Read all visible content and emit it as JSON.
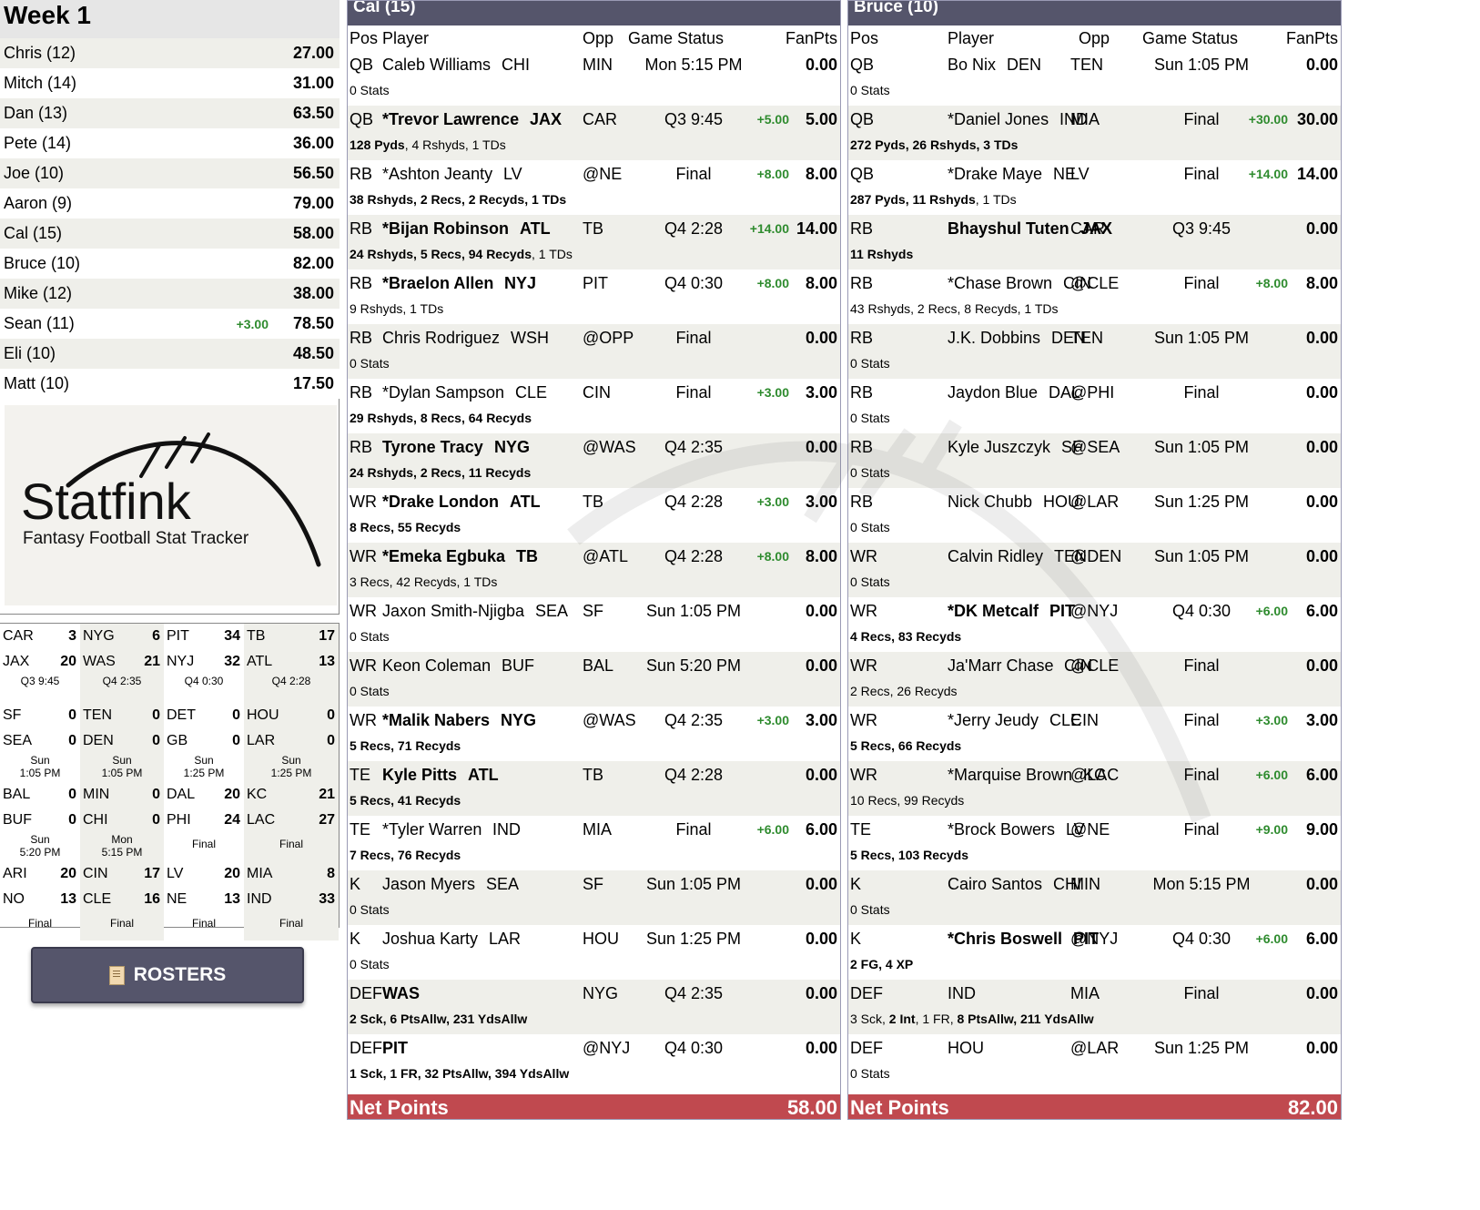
{
  "week_title": "Week 1",
  "standings": [
    {
      "name": "Chris (12)",
      "delta": "",
      "score": "27.00"
    },
    {
      "name": "Mitch (14)",
      "delta": "",
      "score": "31.00"
    },
    {
      "name": "Dan (13)",
      "delta": "",
      "score": "63.50"
    },
    {
      "name": "Pete (14)",
      "delta": "",
      "score": "36.00"
    },
    {
      "name": "Joe (10)",
      "delta": "",
      "score": "56.50"
    },
    {
      "name": "Aaron (9)",
      "delta": "",
      "score": "79.00"
    },
    {
      "name": "Cal (15)",
      "delta": "",
      "score": "58.00"
    },
    {
      "name": "Bruce (10)",
      "delta": "",
      "score": "82.00"
    },
    {
      "name": "Mike (12)",
      "delta": "",
      "score": "38.00"
    },
    {
      "name": "Sean (11)",
      "delta": "+3.00",
      "score": "78.50"
    },
    {
      "name": "Eli (10)",
      "delta": "",
      "score": "48.50"
    },
    {
      "name": "Matt (10)",
      "delta": "",
      "score": "17.50"
    }
  ],
  "logo": {
    "name": "Statfink",
    "tagline": "Fantasy Football Stat Tracker"
  },
  "games": [
    {
      "t1": "CAR",
      "s1": "3",
      "t2": "JAX",
      "s2": "20",
      "status": [
        "Q3 9:45"
      ]
    },
    {
      "t1": "NYG",
      "s1": "6",
      "t2": "WAS",
      "s2": "21",
      "status": [
        "Q4 2:35"
      ]
    },
    {
      "t1": "PIT",
      "s1": "34",
      "t2": "NYJ",
      "s2": "32",
      "status": [
        "Q4 0:30"
      ]
    },
    {
      "t1": "TB",
      "s1": "17",
      "t2": "ATL",
      "s2": "13",
      "status": [
        "Q4 2:28"
      ]
    },
    {
      "t1": "SF",
      "s1": "0",
      "t2": "SEA",
      "s2": "0",
      "status": [
        "Sun",
        "1:05 PM"
      ]
    },
    {
      "t1": "TEN",
      "s1": "0",
      "t2": "DEN",
      "s2": "0",
      "status": [
        "Sun",
        "1:05 PM"
      ]
    },
    {
      "t1": "DET",
      "s1": "0",
      "t2": "GB",
      "s2": "0",
      "status": [
        "Sun",
        "1:25 PM"
      ]
    },
    {
      "t1": "HOU",
      "s1": "0",
      "t2": "LAR",
      "s2": "0",
      "status": [
        "Sun",
        "1:25 PM"
      ]
    },
    {
      "t1": "BAL",
      "s1": "0",
      "t2": "BUF",
      "s2": "0",
      "status": [
        "Sun",
        "5:20 PM"
      ]
    },
    {
      "t1": "MIN",
      "s1": "0",
      "t2": "CHI",
      "s2": "0",
      "status": [
        "Mon",
        "5:15 PM"
      ]
    },
    {
      "t1": "DAL",
      "s1": "20",
      "t2": "PHI",
      "s2": "24",
      "status": [
        "Final"
      ]
    },
    {
      "t1": "KC",
      "s1": "21",
      "t2": "LAC",
      "s2": "27",
      "status": [
        "Final"
      ]
    },
    {
      "t1": "ARI",
      "s1": "20",
      "t2": "NO",
      "s2": "13",
      "status": [
        "Final"
      ]
    },
    {
      "t1": "CIN",
      "s1": "17",
      "t2": "CLE",
      "s2": "16",
      "status": [
        "Final"
      ]
    },
    {
      "t1": "LV",
      "s1": "20",
      "t2": "NE",
      "s2": "13",
      "status": [
        "Final"
      ]
    },
    {
      "t1": "MIA",
      "s1": "8",
      "t2": "IND",
      "s2": "33",
      "status": [
        "Final"
      ]
    }
  ],
  "rosters_button": "ROSTERS",
  "columns": {
    "pos": "Pos",
    "player": "Player",
    "opp": "Opp",
    "status": "Game Status",
    "fanpts": "FanPts"
  },
  "teams": [
    {
      "title": "Cal (15)",
      "net_label": "Net Points",
      "net": "58.00",
      "rows": [
        {
          "pos": "QB",
          "player": "Caleb Williams",
          "team": "CHI",
          "bold": false,
          "opp": "MIN",
          "status": "Mon 5:15 PM",
          "delta": "",
          "pts": "0.00",
          "stats": [
            [
              "0 Stats",
              false
            ]
          ]
        },
        {
          "pos": "QB",
          "player": "*Trevor Lawrence",
          "team": "JAX",
          "bold": true,
          "opp": "CAR",
          "status": "Q3 9:45",
          "delta": "+5.00",
          "pts": "5.00",
          "stats": [
            [
              "128 Pyds",
              true
            ],
            [
              ", 4 Rshyds, 1 TDs",
              false
            ]
          ]
        },
        {
          "pos": "RB",
          "player": "*Ashton Jeanty",
          "team": "LV",
          "bold": false,
          "opp": "@NE",
          "status": "Final",
          "delta": "+8.00",
          "pts": "8.00",
          "stats": [
            [
              "38 Rshyds, 2 Recs, 2 Recyds, 1 TDs",
              true
            ]
          ]
        },
        {
          "pos": "RB",
          "player": "*Bijan Robinson",
          "team": "ATL",
          "bold": true,
          "opp": "TB",
          "status": "Q4 2:28",
          "delta": "+14.00",
          "pts": "14.00",
          "stats": [
            [
              "24 Rshyds, 5 Recs, 94 Recyds",
              true
            ],
            [
              ", 1 TDs",
              false
            ]
          ]
        },
        {
          "pos": "RB",
          "player": "*Braelon Allen",
          "team": "NYJ",
          "bold": true,
          "opp": "PIT",
          "status": "Q4 0:30",
          "delta": "+8.00",
          "pts": "8.00",
          "stats": [
            [
              "9 Rshyds, 1 TDs",
              false
            ]
          ]
        },
        {
          "pos": "RB",
          "player": "Chris Rodriguez",
          "team": "WSH",
          "bold": false,
          "opp": "@OPP",
          "status": "Final",
          "delta": "",
          "pts": "0.00",
          "stats": [
            [
              "0 Stats",
              false
            ]
          ]
        },
        {
          "pos": "RB",
          "player": "*Dylan Sampson",
          "team": "CLE",
          "bold": false,
          "opp": "CIN",
          "status": "Final",
          "delta": "+3.00",
          "pts": "3.00",
          "stats": [
            [
              "29 Rshyds, 8 Recs, 64 Recyds",
              true
            ]
          ]
        },
        {
          "pos": "RB",
          "player": "Tyrone Tracy",
          "team": "NYG",
          "bold": true,
          "opp": "@WAS",
          "status": "Q4 2:35",
          "delta": "",
          "pts": "0.00",
          "stats": [
            [
              "24 Rshyds, 2 Recs, 11 Recyds",
              true
            ]
          ]
        },
        {
          "pos": "WR",
          "player": "*Drake London",
          "team": "ATL",
          "bold": true,
          "opp": "TB",
          "status": "Q4 2:28",
          "delta": "+3.00",
          "pts": "3.00",
          "stats": [
            [
              "8 Recs, 55 Recyds",
              true
            ]
          ]
        },
        {
          "pos": "WR",
          "player": "*Emeka Egbuka",
          "team": "TB",
          "bold": true,
          "opp": "@ATL",
          "status": "Q4 2:28",
          "delta": "+8.00",
          "pts": "8.00",
          "stats": [
            [
              "3 Recs, 42 Recyds, 1 TDs",
              false
            ]
          ]
        },
        {
          "pos": "WR",
          "player": "Jaxon Smith-Njigba",
          "team": "SEA",
          "bold": false,
          "opp": "SF",
          "status": "Sun 1:05 PM",
          "delta": "",
          "pts": "0.00",
          "stats": [
            [
              "0 Stats",
              false
            ]
          ]
        },
        {
          "pos": "WR",
          "player": "Keon Coleman",
          "team": "BUF",
          "bold": false,
          "opp": "BAL",
          "status": "Sun 5:20 PM",
          "delta": "",
          "pts": "0.00",
          "stats": [
            [
              "0 Stats",
              false
            ]
          ]
        },
        {
          "pos": "WR",
          "player": "*Malik Nabers",
          "team": "NYG",
          "bold": true,
          "opp": "@WAS",
          "status": "Q4 2:35",
          "delta": "+3.00",
          "pts": "3.00",
          "stats": [
            [
              "5 Recs, 71 Recyds",
              true
            ]
          ]
        },
        {
          "pos": "TE",
          "player": "Kyle Pitts",
          "team": "ATL",
          "bold": true,
          "opp": "TB",
          "status": "Q4 2:28",
          "delta": "",
          "pts": "0.00",
          "stats": [
            [
              "5 Recs, 41 Recyds",
              true
            ]
          ]
        },
        {
          "pos": "TE",
          "player": "*Tyler Warren",
          "team": "IND",
          "bold": false,
          "opp": "MIA",
          "status": "Final",
          "delta": "+6.00",
          "pts": "6.00",
          "stats": [
            [
              "7 Recs, 76 Recyds",
              true
            ]
          ]
        },
        {
          "pos": "K",
          "player": "Jason Myers",
          "team": "SEA",
          "bold": false,
          "opp": "SF",
          "status": "Sun 1:05 PM",
          "delta": "",
          "pts": "0.00",
          "stats": [
            [
              "0 Stats",
              false
            ]
          ]
        },
        {
          "pos": "K",
          "player": "Joshua Karty",
          "team": "LAR",
          "bold": false,
          "opp": "HOU",
          "status": "Sun 1:25 PM",
          "delta": "",
          "pts": "0.00",
          "stats": [
            [
              "0 Stats",
              false
            ]
          ]
        },
        {
          "pos": "DEF",
          "player": "WAS",
          "team": "",
          "bold": true,
          "opp": "NYG",
          "status": "Q4 2:35",
          "delta": "",
          "pts": "0.00",
          "stats": [
            [
              "2 Sck, 6 PtsAllw, 231 YdsAllw",
              true
            ]
          ]
        },
        {
          "pos": "DEF",
          "player": "PIT",
          "team": "",
          "bold": true,
          "opp": "@NYJ",
          "status": "Q4 0:30",
          "delta": "",
          "pts": "0.00",
          "stats": [
            [
              "1 Sck, 1 FR, 32 PtsAllw, 394 YdsAllw",
              true
            ]
          ]
        }
      ]
    },
    {
      "title": "Bruce (10)",
      "net_label": "Net Points",
      "net": "82.00",
      "rows": [
        {
          "pos": "QB",
          "player": "Bo Nix",
          "team": "DEN",
          "bold": false,
          "opp": "TEN",
          "status": "Sun 1:05 PM",
          "delta": "",
          "pts": "0.00",
          "stats": [
            [
              "0 Stats",
              false
            ]
          ]
        },
        {
          "pos": "QB",
          "player": "*Daniel Jones",
          "team": "IND",
          "bold": false,
          "opp": "MIA",
          "status": "Final",
          "delta": "+30.00",
          "pts": "30.00",
          "stats": [
            [
              "272 Pyds, 26 Rshyds, 3 TDs",
              true
            ]
          ]
        },
        {
          "pos": "QB",
          "player": "*Drake Maye",
          "team": "NE",
          "bold": false,
          "opp": "LV",
          "status": "Final",
          "delta": "+14.00",
          "pts": "14.00",
          "stats": [
            [
              "287 Pyds, 11 Rshyds",
              true
            ],
            [
              ", 1 TDs",
              false
            ]
          ]
        },
        {
          "pos": "RB",
          "player": "Bhayshul Tuten",
          "team": "JAX",
          "bold": true,
          "opp": "CAR",
          "status": "Q3 9:45",
          "delta": "",
          "pts": "0.00",
          "stats": [
            [
              "11 Rshyds",
              true
            ]
          ]
        },
        {
          "pos": "RB",
          "player": "*Chase Brown",
          "team": "CIN",
          "bold": false,
          "opp": "@CLE",
          "status": "Final",
          "delta": "+8.00",
          "pts": "8.00",
          "stats": [
            [
              "43 Rshyds, 2 Recs, 8 Recyds, 1 TDs",
              false
            ]
          ]
        },
        {
          "pos": "RB",
          "player": "J.K. Dobbins",
          "team": "DEN",
          "bold": false,
          "opp": "TEN",
          "status": "Sun 1:05 PM",
          "delta": "",
          "pts": "0.00",
          "stats": [
            [
              "0 Stats",
              false
            ]
          ]
        },
        {
          "pos": "RB",
          "player": "Jaydon Blue",
          "team": "DAL",
          "bold": false,
          "opp": "@PHI",
          "status": "Final",
          "delta": "",
          "pts": "0.00",
          "stats": [
            [
              "0 Stats",
              false
            ]
          ]
        },
        {
          "pos": "RB",
          "player": "Kyle Juszczyk",
          "team": "SF",
          "bold": false,
          "opp": "@SEA",
          "status": "Sun 1:05 PM",
          "delta": "",
          "pts": "0.00",
          "stats": [
            [
              "0 Stats",
              false
            ]
          ]
        },
        {
          "pos": "RB",
          "player": "Nick Chubb",
          "team": "HOU",
          "bold": false,
          "opp": "@LAR",
          "status": "Sun 1:25 PM",
          "delta": "",
          "pts": "0.00",
          "stats": [
            [
              "0 Stats",
              false
            ]
          ]
        },
        {
          "pos": "WR",
          "player": "Calvin Ridley",
          "team": "TEN",
          "bold": false,
          "opp": "@DEN",
          "status": "Sun 1:05 PM",
          "delta": "",
          "pts": "0.00",
          "stats": [
            [
              "0 Stats",
              false
            ]
          ]
        },
        {
          "pos": "WR",
          "player": "*DK Metcalf",
          "team": "PIT",
          "bold": true,
          "opp": "@NYJ",
          "status": "Q4 0:30",
          "delta": "+6.00",
          "pts": "6.00",
          "stats": [
            [
              "4 Recs, 83 Recyds",
              true
            ]
          ]
        },
        {
          "pos": "WR",
          "player": "Ja'Marr Chase",
          "team": "CIN",
          "bold": false,
          "opp": "@CLE",
          "status": "Final",
          "delta": "",
          "pts": "0.00",
          "stats": [
            [
              "2 Recs, 26 Recyds",
              false
            ]
          ]
        },
        {
          "pos": "WR",
          "player": "*Jerry Jeudy",
          "team": "CLE",
          "bold": false,
          "opp": "CIN",
          "status": "Final",
          "delta": "+3.00",
          "pts": "3.00",
          "stats": [
            [
              "5 Recs, 66 Recyds",
              true
            ]
          ]
        },
        {
          "pos": "WR",
          "player": "*Marquise Brown",
          "team": "KC",
          "bold": false,
          "opp": "@LAC",
          "status": "Final",
          "delta": "+6.00",
          "pts": "6.00",
          "stats": [
            [
              "10 Recs, 99 Recyds",
              false
            ]
          ]
        },
        {
          "pos": "TE",
          "player": "*Brock Bowers",
          "team": "LV",
          "bold": false,
          "opp": "@NE",
          "status": "Final",
          "delta": "+9.00",
          "pts": "9.00",
          "stats": [
            [
              "5 Recs, 103 Recyds",
              true
            ]
          ]
        },
        {
          "pos": "K",
          "player": "Cairo Santos",
          "team": "CHI",
          "bold": false,
          "opp": "MIN",
          "status": "Mon 5:15 PM",
          "delta": "",
          "pts": "0.00",
          "stats": [
            [
              "0 Stats",
              false
            ]
          ]
        },
        {
          "pos": "K",
          "player": "*Chris Boswell",
          "team": "PIT",
          "bold": true,
          "opp": "@NYJ",
          "status": "Q4 0:30",
          "delta": "+6.00",
          "pts": "6.00",
          "stats": [
            [
              "2 FG, 4 XP",
              true
            ]
          ]
        },
        {
          "pos": "DEF",
          "player": "IND",
          "team": "",
          "bold": false,
          "opp": "MIA",
          "status": "Final",
          "delta": "",
          "pts": "0.00",
          "stats": [
            [
              "3 Sck, ",
              false
            ],
            [
              "2 Int",
              true
            ],
            [
              ", 1 FR, ",
              false
            ],
            [
              "8 PtsAllw, 211 YdsAllw",
              true
            ]
          ]
        },
        {
          "pos": "DEF",
          "player": "HOU",
          "team": "",
          "bold": false,
          "opp": "@LAR",
          "status": "Sun 1:25 PM",
          "delta": "",
          "pts": "0.00",
          "stats": [
            [
              "0 Stats",
              false
            ]
          ]
        }
      ]
    }
  ]
}
